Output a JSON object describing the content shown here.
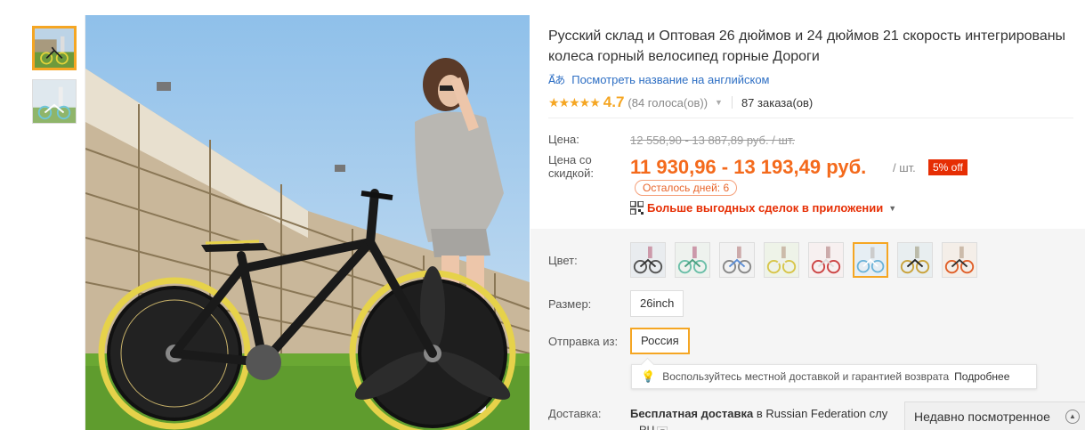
{
  "product": {
    "title": "Русский склад и Оптовая 26 дюймов и 24 дюймов 21 скорость интегрированы колеса горный велосипед горные Дороги",
    "translate_link": "Посмотреть название на английском",
    "translate_icon": "translate-icon",
    "rating_value": "4.7",
    "rating_stars": 4.7,
    "votes": "(84 голоса(ов))",
    "orders": "87 заказа(ов)"
  },
  "price": {
    "label_price": "Цена:",
    "old_price": "12 558,90 - 13 887,89 руб. / шт.",
    "label_discount": "Цена со скидкой:",
    "new_price": "11 930,96 - 13 193,49 руб.",
    "unit": "/ шт.",
    "discount_badge": "5% off",
    "days_left": "Осталось дней: 6",
    "app_deals": "Больше выгодных сделок в приложении"
  },
  "options": {
    "color_label": "Цвет:",
    "color_swatches": [
      "bike-gray-wheels",
      "bike-green-frame",
      "bike-white-blue",
      "bike-white-yellow",
      "bike-red-white",
      "bike-blue-white",
      "bike-black-gold",
      "bike-orange"
    ],
    "selected_color_index": 5,
    "size_label": "Размер:",
    "size_value": "26inch",
    "ship_label": "Отправка из:",
    "ship_value": "Россия",
    "tip_text": "Воспользуйтесь местной доставкой и гарантией возврата",
    "tip_more": "Подробнее",
    "delivery_label": "Доставка:",
    "delivery_bold": "Бесплатная доставка",
    "delivery_rest": " в Russian Federation слу",
    "delivery_country": "RU"
  },
  "recent": {
    "label": "Недавно посмотренное"
  },
  "colors": {
    "accent": "#f5a623",
    "price": "#f46a1c",
    "badge": "#e62e04",
    "link": "#2e6fc4"
  }
}
